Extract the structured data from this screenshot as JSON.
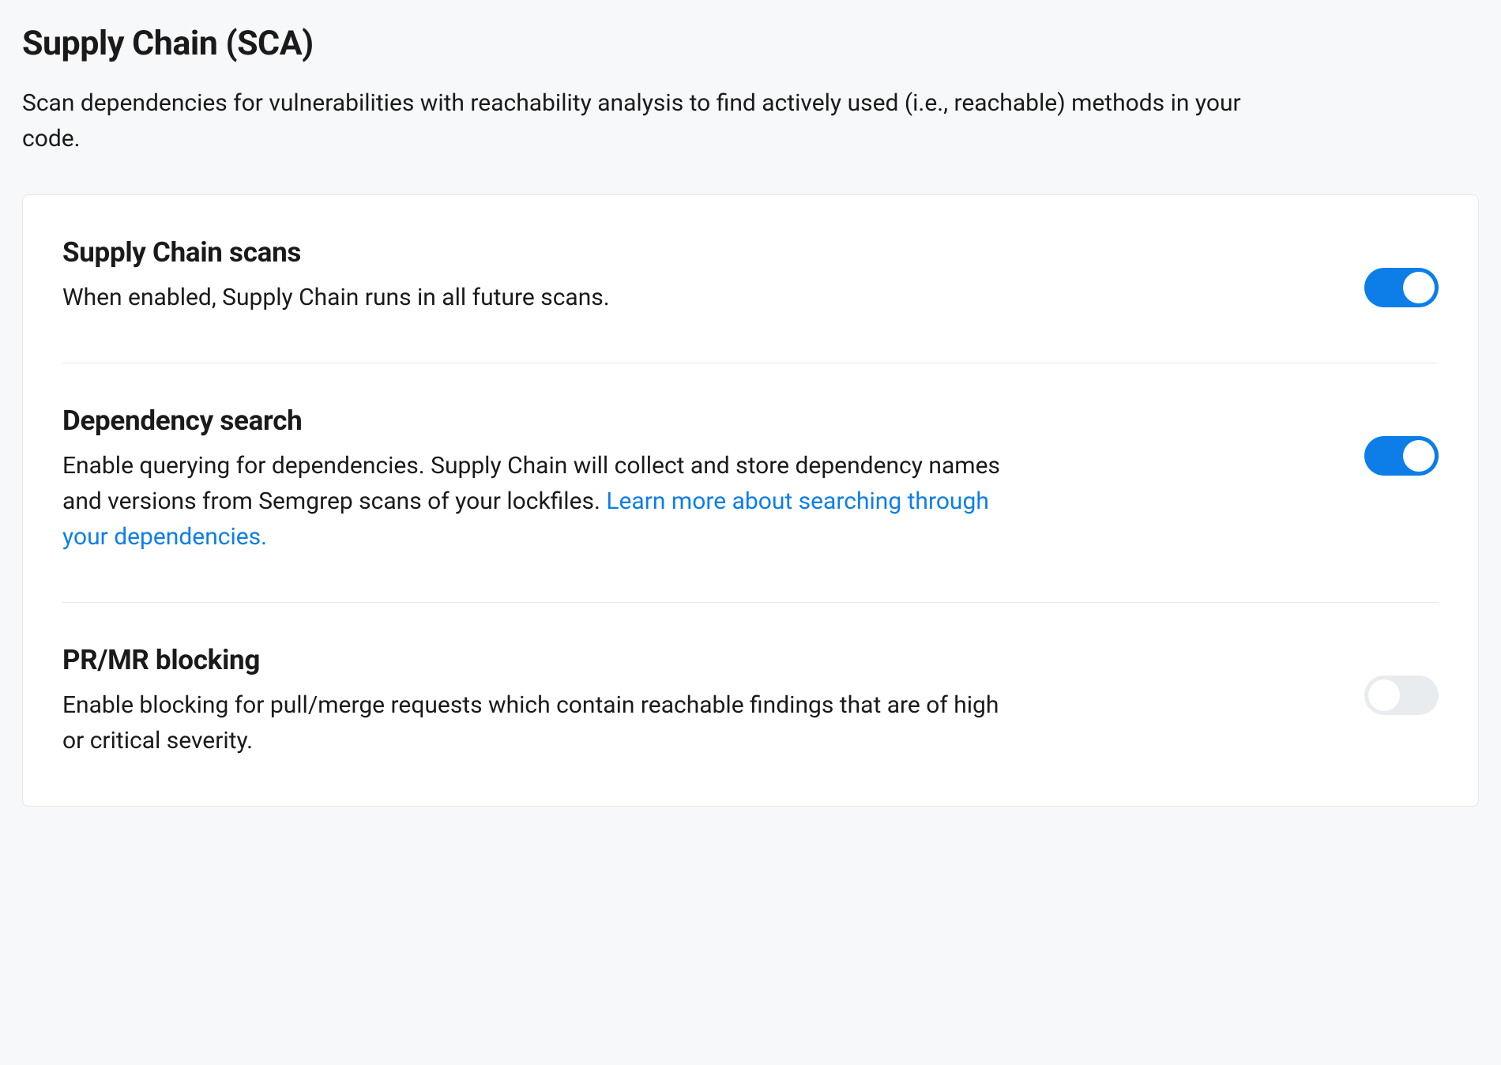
{
  "page": {
    "title": "Supply Chain (SCA)",
    "subtitle": "Scan dependencies for vulnerabilities with reachability analysis to find actively used (i.e., reachable) methods in your code."
  },
  "settings": {
    "supplyChainScans": {
      "title": "Supply Chain scans",
      "description": "When enabled, Supply Chain runs in all future scans.",
      "enabled": true
    },
    "dependencySearch": {
      "title": "Dependency search",
      "description": "Enable querying for dependencies. Supply Chain will collect and store dependency names and versions from Semgrep scans of your lockfiles. ",
      "linkText": "Learn more about searching through your dependencies.",
      "enabled": true
    },
    "prMrBlocking": {
      "title": "PR/MR blocking",
      "description": "Enable blocking for pull/merge requests which contain reachable findings that are of high or critical severity.",
      "enabled": false
    }
  },
  "colors": {
    "accent": "#0d7ee8",
    "toggleOff": "#e9ecef"
  }
}
